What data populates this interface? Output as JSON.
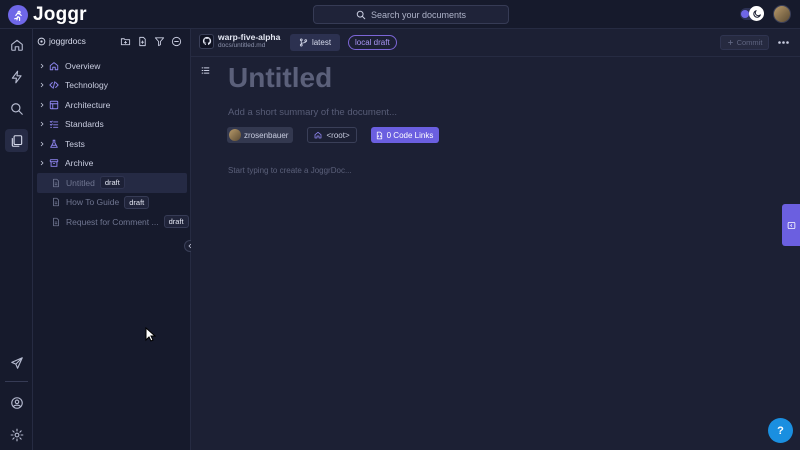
{
  "app": {
    "name": "Joggr"
  },
  "search": {
    "placeholder": "Search your documents"
  },
  "rail": {
    "top_icons": [
      "home-icon",
      "bolt-icon",
      "search-icon",
      "documents-icon"
    ],
    "bottom_icons": [
      "send-icon",
      "account-icon",
      "settings-icon"
    ],
    "active": "documents-icon"
  },
  "explorer": {
    "workspace": "joggrdocs",
    "folders": [
      {
        "label": "Overview",
        "icon": "home-icon"
      },
      {
        "label": "Technology",
        "icon": "code-icon"
      },
      {
        "label": "Architecture",
        "icon": "layout-icon"
      },
      {
        "label": "Standards",
        "icon": "list-check-icon"
      },
      {
        "label": "Tests",
        "icon": "flask-icon"
      },
      {
        "label": "Archive",
        "icon": "archive-icon"
      }
    ],
    "docs": [
      {
        "label": "Untitled",
        "badge": "draft",
        "selected": true
      },
      {
        "label": "How To Guide",
        "badge": "draft",
        "selected": false
      },
      {
        "label": "Request for Comment ...",
        "badge": "draft",
        "selected": false
      }
    ]
  },
  "header": {
    "repo_name": "warp-five-alpha",
    "repo_path": "docs/untitled.md",
    "branch": "latest",
    "status": "local draft",
    "commit_label": "Commit"
  },
  "document": {
    "title": "Untitled",
    "summary_placeholder": "Add a short summary of the document...",
    "author": "zrosenbauer",
    "location": "<root>",
    "code_links": "0 Code Links",
    "body_placeholder": "Start typing to create a JoggrDoc..."
  },
  "help": {
    "label": "?"
  },
  "colors": {
    "accent": "#6b5fe0",
    "help": "#1a8fe0",
    "background": "#1c2034",
    "panel": "#161a2c"
  }
}
